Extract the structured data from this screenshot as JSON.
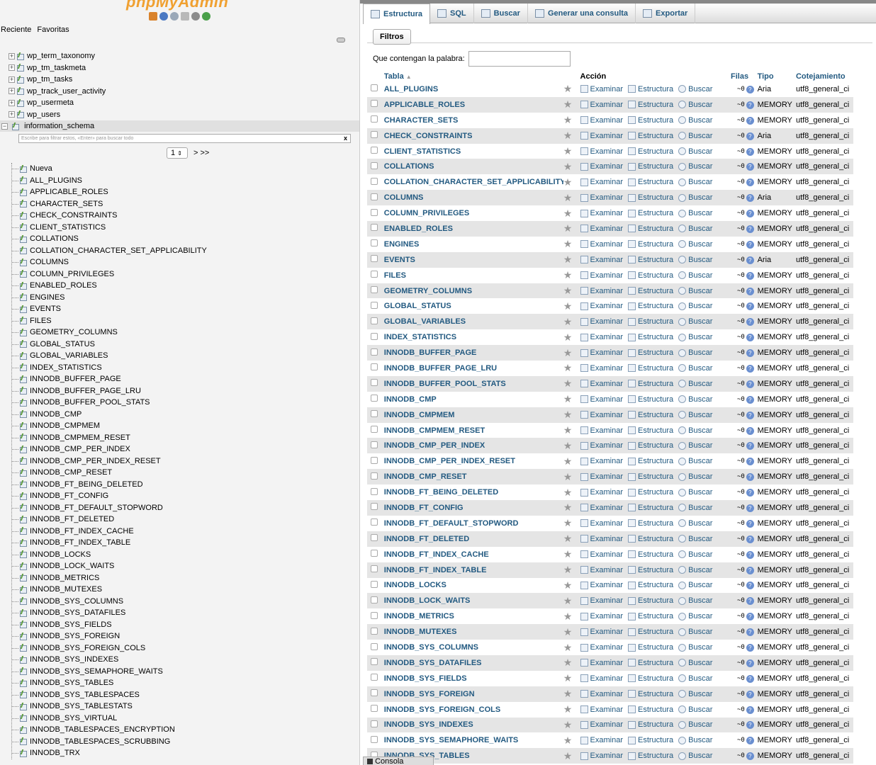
{
  "nav": {
    "logo": "phpMyAdmin",
    "tabs": [
      "Reciente",
      "Favoritas"
    ],
    "wp_tables": [
      "wp_term_taxonomy",
      "wp_tm_taskmeta",
      "wp_tm_tasks",
      "wp_track_user_activity",
      "wp_usermeta",
      "wp_users"
    ],
    "schema": "information_schema",
    "filter_placeholder": "Escribe para filtrar estos, «Enter» para buscar todo",
    "filter_clear": "x",
    "page": "1",
    "next": "> >>",
    "new_label": "Nueva",
    "tables": [
      "ALL_PLUGINS",
      "APPLICABLE_ROLES",
      "CHARACTER_SETS",
      "CHECK_CONSTRAINTS",
      "CLIENT_STATISTICS",
      "COLLATIONS",
      "COLLATION_CHARACTER_SET_APPLICABILITY",
      "COLUMNS",
      "COLUMN_PRIVILEGES",
      "ENABLED_ROLES",
      "ENGINES",
      "EVENTS",
      "FILES",
      "GEOMETRY_COLUMNS",
      "GLOBAL_STATUS",
      "GLOBAL_VARIABLES",
      "INDEX_STATISTICS",
      "INNODB_BUFFER_PAGE",
      "INNODB_BUFFER_PAGE_LRU",
      "INNODB_BUFFER_POOL_STATS",
      "INNODB_CMP",
      "INNODB_CMPMEM",
      "INNODB_CMPMEM_RESET",
      "INNODB_CMP_PER_INDEX",
      "INNODB_CMP_PER_INDEX_RESET",
      "INNODB_CMP_RESET",
      "INNODB_FT_BEING_DELETED",
      "INNODB_FT_CONFIG",
      "INNODB_FT_DEFAULT_STOPWORD",
      "INNODB_FT_DELETED",
      "INNODB_FT_INDEX_CACHE",
      "INNODB_FT_INDEX_TABLE",
      "INNODB_LOCKS",
      "INNODB_LOCK_WAITS",
      "INNODB_METRICS",
      "INNODB_MUTEXES",
      "INNODB_SYS_COLUMNS",
      "INNODB_SYS_DATAFILES",
      "INNODB_SYS_FIELDS",
      "INNODB_SYS_FOREIGN",
      "INNODB_SYS_FOREIGN_COLS",
      "INNODB_SYS_INDEXES",
      "INNODB_SYS_SEMAPHORE_WAITS",
      "INNODB_SYS_TABLES",
      "INNODB_SYS_TABLESPACES",
      "INNODB_SYS_TABLESTATS",
      "INNODB_SYS_VIRTUAL",
      "INNODB_TABLESPACES_ENCRYPTION",
      "INNODB_TABLESPACES_SCRUBBING",
      "INNODB_TRX"
    ]
  },
  "main": {
    "tabs": [
      {
        "label": "Estructura",
        "active": true
      },
      {
        "label": "SQL",
        "active": false
      },
      {
        "label": "Buscar",
        "active": false
      },
      {
        "label": "Generar una consulta",
        "active": false
      },
      {
        "label": "Exportar",
        "active": false
      }
    ],
    "filter_legend": "Filtros",
    "filter_label": "Que contengan la palabra:",
    "filter_value": "",
    "headers": {
      "table": "Tabla",
      "sort": "▲",
      "action": "Acción",
      "rows": "Filas",
      "type": "Tipo",
      "collation": "Cotejamiento"
    },
    "actions": {
      "browse": "Examinar",
      "structure": "Estructura",
      "search": "Buscar"
    },
    "rows_value": "~0",
    "rows": [
      {
        "name": "ALL_PLUGINS",
        "type": "Aria",
        "coll": "utf8_general_ci"
      },
      {
        "name": "APPLICABLE_ROLES",
        "type": "MEMORY",
        "coll": "utf8_general_ci"
      },
      {
        "name": "CHARACTER_SETS",
        "type": "MEMORY",
        "coll": "utf8_general_ci"
      },
      {
        "name": "CHECK_CONSTRAINTS",
        "type": "Aria",
        "coll": "utf8_general_ci"
      },
      {
        "name": "CLIENT_STATISTICS",
        "type": "MEMORY",
        "coll": "utf8_general_ci"
      },
      {
        "name": "COLLATIONS",
        "type": "MEMORY",
        "coll": "utf8_general_ci"
      },
      {
        "name": "COLLATION_CHARACTER_SET_APPLICABILITY",
        "type": "MEMORY",
        "coll": "utf8_general_ci"
      },
      {
        "name": "COLUMNS",
        "type": "Aria",
        "coll": "utf8_general_ci"
      },
      {
        "name": "COLUMN_PRIVILEGES",
        "type": "MEMORY",
        "coll": "utf8_general_ci"
      },
      {
        "name": "ENABLED_ROLES",
        "type": "MEMORY",
        "coll": "utf8_general_ci"
      },
      {
        "name": "ENGINES",
        "type": "MEMORY",
        "coll": "utf8_general_ci"
      },
      {
        "name": "EVENTS",
        "type": "Aria",
        "coll": "utf8_general_ci"
      },
      {
        "name": "FILES",
        "type": "MEMORY",
        "coll": "utf8_general_ci"
      },
      {
        "name": "GEOMETRY_COLUMNS",
        "type": "MEMORY",
        "coll": "utf8_general_ci"
      },
      {
        "name": "GLOBAL_STATUS",
        "type": "MEMORY",
        "coll": "utf8_general_ci"
      },
      {
        "name": "GLOBAL_VARIABLES",
        "type": "MEMORY",
        "coll": "utf8_general_ci"
      },
      {
        "name": "INDEX_STATISTICS",
        "type": "MEMORY",
        "coll": "utf8_general_ci"
      },
      {
        "name": "INNODB_BUFFER_PAGE",
        "type": "MEMORY",
        "coll": "utf8_general_ci"
      },
      {
        "name": "INNODB_BUFFER_PAGE_LRU",
        "type": "MEMORY",
        "coll": "utf8_general_ci"
      },
      {
        "name": "INNODB_BUFFER_POOL_STATS",
        "type": "MEMORY",
        "coll": "utf8_general_ci"
      },
      {
        "name": "INNODB_CMP",
        "type": "MEMORY",
        "coll": "utf8_general_ci"
      },
      {
        "name": "INNODB_CMPMEM",
        "type": "MEMORY",
        "coll": "utf8_general_ci"
      },
      {
        "name": "INNODB_CMPMEM_RESET",
        "type": "MEMORY",
        "coll": "utf8_general_ci"
      },
      {
        "name": "INNODB_CMP_PER_INDEX",
        "type": "MEMORY",
        "coll": "utf8_general_ci"
      },
      {
        "name": "INNODB_CMP_PER_INDEX_RESET",
        "type": "MEMORY",
        "coll": "utf8_general_ci"
      },
      {
        "name": "INNODB_CMP_RESET",
        "type": "MEMORY",
        "coll": "utf8_general_ci"
      },
      {
        "name": "INNODB_FT_BEING_DELETED",
        "type": "MEMORY",
        "coll": "utf8_general_ci"
      },
      {
        "name": "INNODB_FT_CONFIG",
        "type": "MEMORY",
        "coll": "utf8_general_ci"
      },
      {
        "name": "INNODB_FT_DEFAULT_STOPWORD",
        "type": "MEMORY",
        "coll": "utf8_general_ci"
      },
      {
        "name": "INNODB_FT_DELETED",
        "type": "MEMORY",
        "coll": "utf8_general_ci"
      },
      {
        "name": "INNODB_FT_INDEX_CACHE",
        "type": "MEMORY",
        "coll": "utf8_general_ci"
      },
      {
        "name": "INNODB_FT_INDEX_TABLE",
        "type": "MEMORY",
        "coll": "utf8_general_ci"
      },
      {
        "name": "INNODB_LOCKS",
        "type": "MEMORY",
        "coll": "utf8_general_ci"
      },
      {
        "name": "INNODB_LOCK_WAITS",
        "type": "MEMORY",
        "coll": "utf8_general_ci"
      },
      {
        "name": "INNODB_METRICS",
        "type": "MEMORY",
        "coll": "utf8_general_ci"
      },
      {
        "name": "INNODB_MUTEXES",
        "type": "MEMORY",
        "coll": "utf8_general_ci"
      },
      {
        "name": "INNODB_SYS_COLUMNS",
        "type": "MEMORY",
        "coll": "utf8_general_ci"
      },
      {
        "name": "INNODB_SYS_DATAFILES",
        "type": "MEMORY",
        "coll": "utf8_general_ci"
      },
      {
        "name": "INNODB_SYS_FIELDS",
        "type": "MEMORY",
        "coll": "utf8_general_ci"
      },
      {
        "name": "INNODB_SYS_FOREIGN",
        "type": "MEMORY",
        "coll": "utf8_general_ci"
      },
      {
        "name": "INNODB_SYS_FOREIGN_COLS",
        "type": "MEMORY",
        "coll": "utf8_general_ci"
      },
      {
        "name": "INNODB_SYS_INDEXES",
        "type": "MEMORY",
        "coll": "utf8_general_ci"
      },
      {
        "name": "INNODB_SYS_SEMAPHORE_WAITS",
        "type": "MEMORY",
        "coll": "utf8_general_ci"
      },
      {
        "name": "INNODB_SYS_TABLES",
        "type": "MEMORY",
        "coll": "utf8_general_ci"
      }
    ],
    "console_label": "Consola"
  }
}
